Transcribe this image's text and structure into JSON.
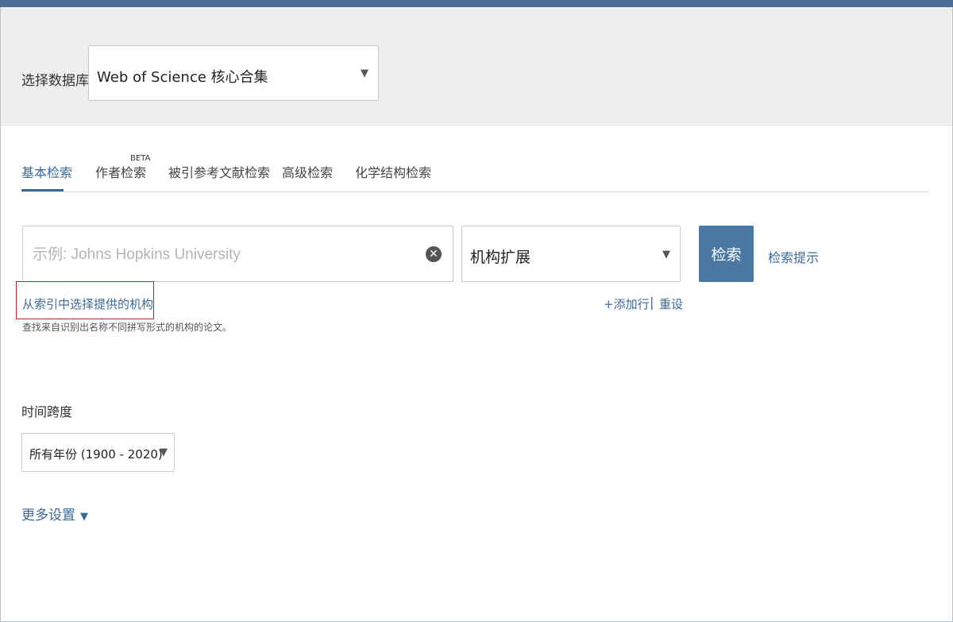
{
  "database": {
    "label": "选择数据库",
    "selected": "Web of Science 核心合集"
  },
  "tabs": [
    {
      "label": "基本检索",
      "active": true
    },
    {
      "label": "作者检索",
      "badge": "BETA"
    },
    {
      "label": "被引参考文献检索"
    },
    {
      "label": "高级检索"
    },
    {
      "label": "化学结构检索"
    }
  ],
  "search": {
    "placeholder": "示例: Johns Hopkins University",
    "value": "",
    "field": "机构扩展",
    "button": "检索",
    "tips": "检索提示"
  },
  "index": {
    "link": "从索引中选择提供的机构",
    "description": "查找来自识别出名称不同拼写形式的机构的论文。"
  },
  "row_actions": {
    "add": "+添加行",
    "separator": "|",
    "reset": "重设"
  },
  "timespan": {
    "label": "时间跨度",
    "selected": "所有年份 (1900 - 2020)"
  },
  "more_settings": {
    "label": "更多设置",
    "icon": "▼"
  },
  "colors": {
    "accent": "#3c6a96",
    "button": "#4a77a3",
    "highlight_border": "#b22a2a"
  }
}
